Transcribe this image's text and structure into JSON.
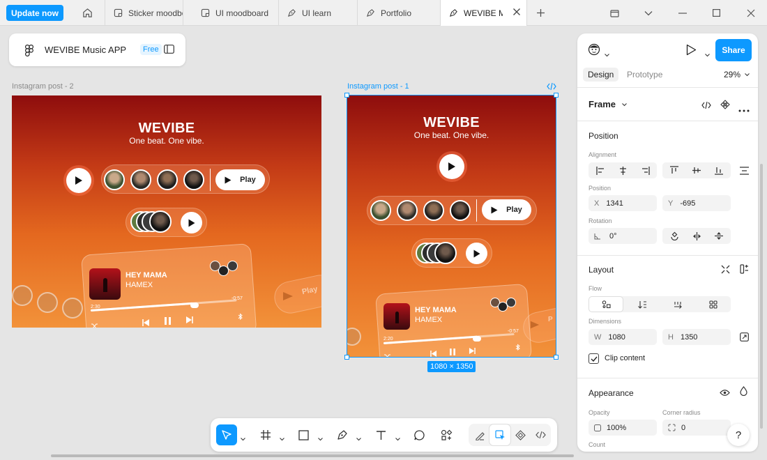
{
  "tabbar": {
    "update_label": "Update now",
    "tabs": [
      {
        "label": "Sticker moodbo"
      },
      {
        "label": "UI moodboard"
      },
      {
        "label": "UI learn"
      },
      {
        "label": "Portfolio"
      },
      {
        "label": "WEVIBE Mu"
      }
    ]
  },
  "file": {
    "name": "WEVIBE Music APP",
    "plan": "Free"
  },
  "frames": {
    "post2": {
      "label": "Instagram post - 2",
      "title": "WEVIBE",
      "tagline": "One beat. One vibe.",
      "play_label": "Play",
      "play_label_faded": "Play",
      "song": "HEY MAMA",
      "artist": "HAMEX",
      "elapsed": "2:30",
      "remaining": "-0:57"
    },
    "post1": {
      "label": "Instagram post - 1",
      "title": "WEVIBE",
      "tagline": "One beat. One vibe.",
      "play_label": "Play",
      "play_label_faded": "P",
      "song": "HEY MAMA",
      "artist": "HAMEX",
      "elapsed": "2:20",
      "remaining": "-0:57",
      "dimensions_badge": "1080 × 1350"
    }
  },
  "panel": {
    "share_label": "Share",
    "tabs": {
      "design": "Design",
      "prototype": "Prototype"
    },
    "zoom": "29%",
    "frame_label": "Frame",
    "position": {
      "title": "Position",
      "alignment_label": "Alignment",
      "position_label": "Position",
      "x_prefix": "X",
      "x": "1341",
      "y_prefix": "Y",
      "y": "-695",
      "rotation_label": "Rotation",
      "rotation": "0°"
    },
    "layout": {
      "title": "Layout",
      "flow_label": "Flow",
      "dimensions_label": "Dimensions",
      "w_prefix": "W",
      "w": "1080",
      "h_prefix": "H",
      "h": "1350",
      "clip_label": "Clip content",
      "clip_checked": true
    },
    "appearance": {
      "title": "Appearance",
      "opacity_label": "Opacity",
      "opacity": "100%",
      "radius_label": "Corner radius",
      "radius": "0",
      "count_label": "Count"
    }
  },
  "help_label": "?",
  "colors": {
    "accent": "#0d99ff",
    "frame_top": "#8e0d0d",
    "frame_bottom": "#f2923a"
  }
}
